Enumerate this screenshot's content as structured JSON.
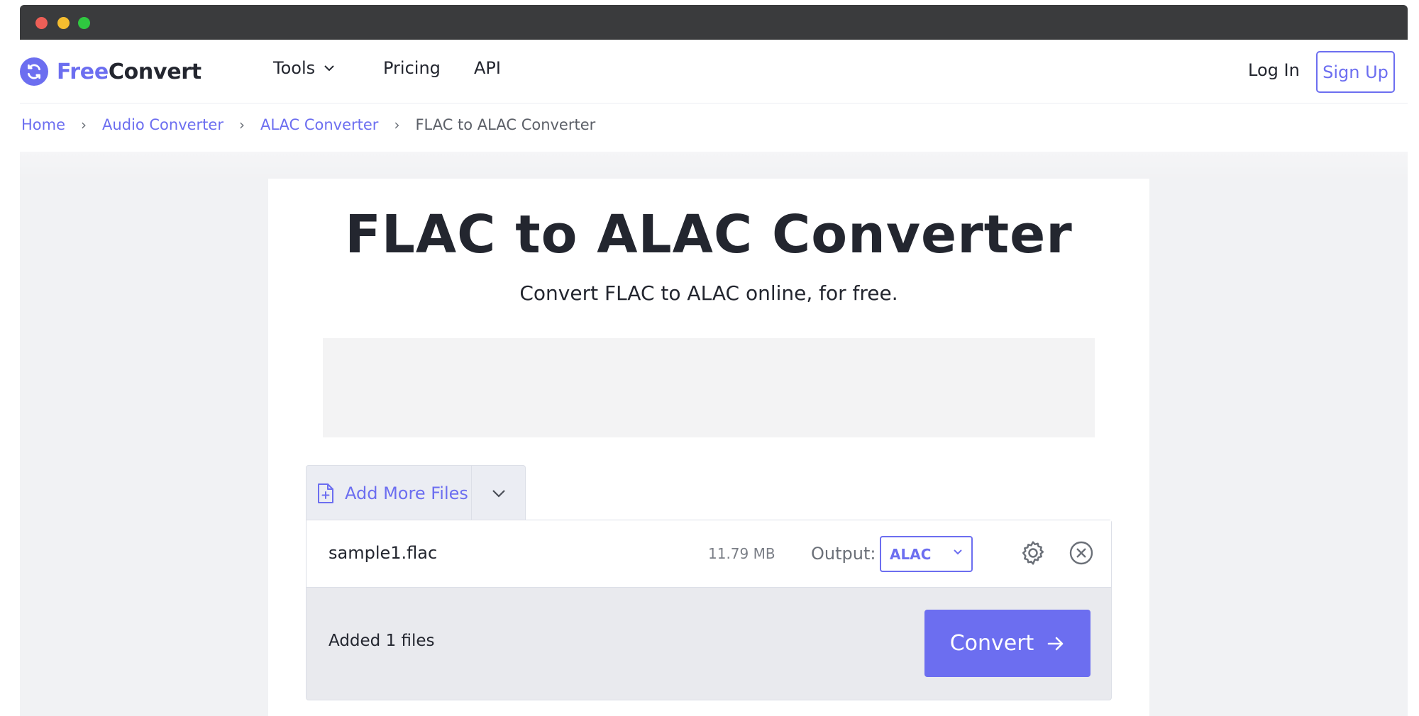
{
  "brand": {
    "name_part1": "Free",
    "name_part2": "Convert"
  },
  "nav": {
    "tools": "Tools",
    "pricing": "Pricing",
    "api": "API",
    "login": "Log In",
    "signup": "Sign Up"
  },
  "breadcrumb": [
    "Home",
    "Audio Converter",
    "ALAC Converter",
    "FLAC to ALAC Converter"
  ],
  "hero": {
    "title": "FLAC to ALAC Converter",
    "subtitle": "Convert FLAC to ALAC online, for free."
  },
  "uploader": {
    "add_more": "Add More Files",
    "file": {
      "name": "sample1.flac",
      "size": "11.79 MB",
      "output_label": "Output:",
      "output_value": "ALAC"
    },
    "added_text": "Added 1 files",
    "convert_label": "Convert"
  },
  "colors": {
    "accent": "#6c6ef0",
    "text": "#23262f",
    "titlebar": "#3a3b3d"
  },
  "icons": [
    "logo-refresh-icon",
    "chevron-down-icon",
    "file-plus-icon",
    "gear-icon",
    "close-circle-icon",
    "arrow-right-icon"
  ]
}
